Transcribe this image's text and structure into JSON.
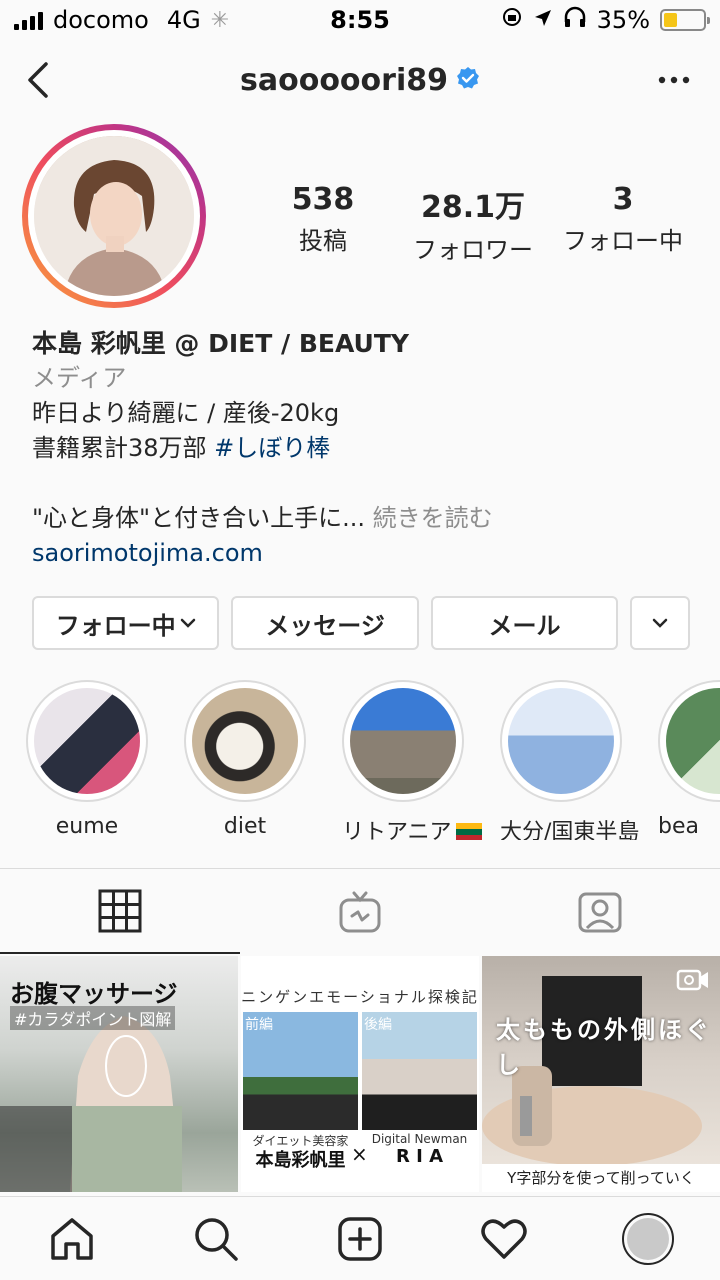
{
  "status_bar": {
    "carrier": "docomo",
    "network": "4G",
    "time": "8:55",
    "battery": "35%",
    "battery_level": 0.35
  },
  "header": {
    "username": "saooooori89",
    "verified": true
  },
  "stats": [
    {
      "value": "538",
      "label": "投稿"
    },
    {
      "value": "28.1万",
      "label": "フォロワー"
    },
    {
      "value": "3",
      "label": "フォロー中"
    }
  ],
  "bio": {
    "name": "本島 彩帆里 @ DIET / BEAUTY",
    "category": "メディア",
    "line1": "昨日より綺麗に / 産後-20kg",
    "line2_text": "書籍累計38万部 ",
    "line2_tag": "#しぼり棒",
    "line3_text": "\"心と身体\"と付き合い上手に... ",
    "line3_more": "続きを読む",
    "website": "saorimotojima.com"
  },
  "actions": {
    "following": "フォロー中",
    "message": "メッセージ",
    "mail": "メール"
  },
  "highlights": [
    {
      "label": "eume"
    },
    {
      "label": "diet"
    },
    {
      "label": "リトアニア"
    },
    {
      "label": "大分/国東半島"
    },
    {
      "label": "bea"
    }
  ],
  "posts": {
    "post1": {
      "title": "お腹マッサージ",
      "subtitle": "#カラダポイント図解"
    },
    "post2": {
      "heading": "ニンゲンエモーショナル探検記",
      "left_tag": "前編",
      "right_tag": "後編",
      "left_caption": "ダイエット美容家",
      "left_name": "本島彩帆里",
      "cross": "×",
      "right_caption": "Digital Newman",
      "right_name": "R I A"
    },
    "post3": {
      "title": "太ももの外側ほぐし",
      "caption": "Y字部分を使って削っていく"
    }
  },
  "colors": {
    "link": "#00376b",
    "muted": "#8e8e8e",
    "verified": "#3897f0"
  }
}
